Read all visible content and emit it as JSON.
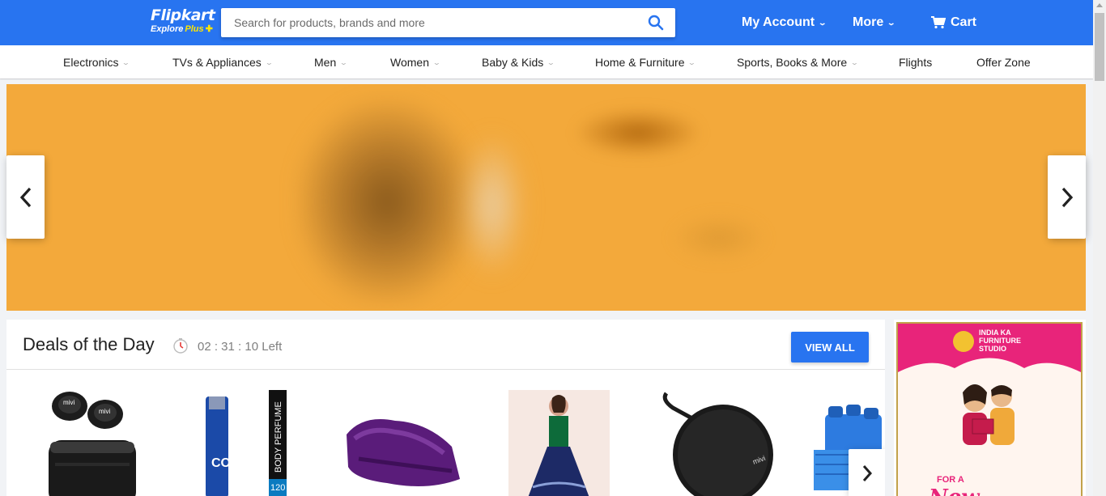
{
  "header": {
    "brand": "Flipkart",
    "tagline": "Explore",
    "tagline_plus": "Plus",
    "search_placeholder": "Search for products, brands and more",
    "my_account": "My Account",
    "more": "More",
    "cart": "Cart"
  },
  "categories": [
    "Electronics",
    "TVs & Appliances",
    "Men",
    "Women",
    "Baby & Kids",
    "Home & Furniture",
    "Sports, Books & More",
    "Flights",
    "Offer Zone"
  ],
  "deals": {
    "title": "Deals of the Day",
    "timer": "02 : 31 : 10 Left",
    "view_all": "VIEW ALL"
  },
  "products": [
    {
      "name": "mivi earbuds",
      "label": "mivi"
    },
    {
      "name": "wild stone code body perfume",
      "label": "BODY PERFUME",
      "brand": "CODE",
      "qty": "120"
    },
    {
      "name": "purple blanket"
    },
    {
      "name": "girls lehenga"
    },
    {
      "name": "mivi bluetooth speaker",
      "label": "mivi"
    },
    {
      "name": "blue storage containers"
    }
  ],
  "ad": {
    "brand_line1": "INDIA KA",
    "brand_line2": "FURNITURE",
    "brand_line3": "STUDIO",
    "headline_small": "FOR A",
    "headline": "New"
  },
  "colors": {
    "primary": "#2874f0",
    "banner": "#f3a93b",
    "accent": "#ffe500",
    "ad_pink": "#e8247a"
  }
}
